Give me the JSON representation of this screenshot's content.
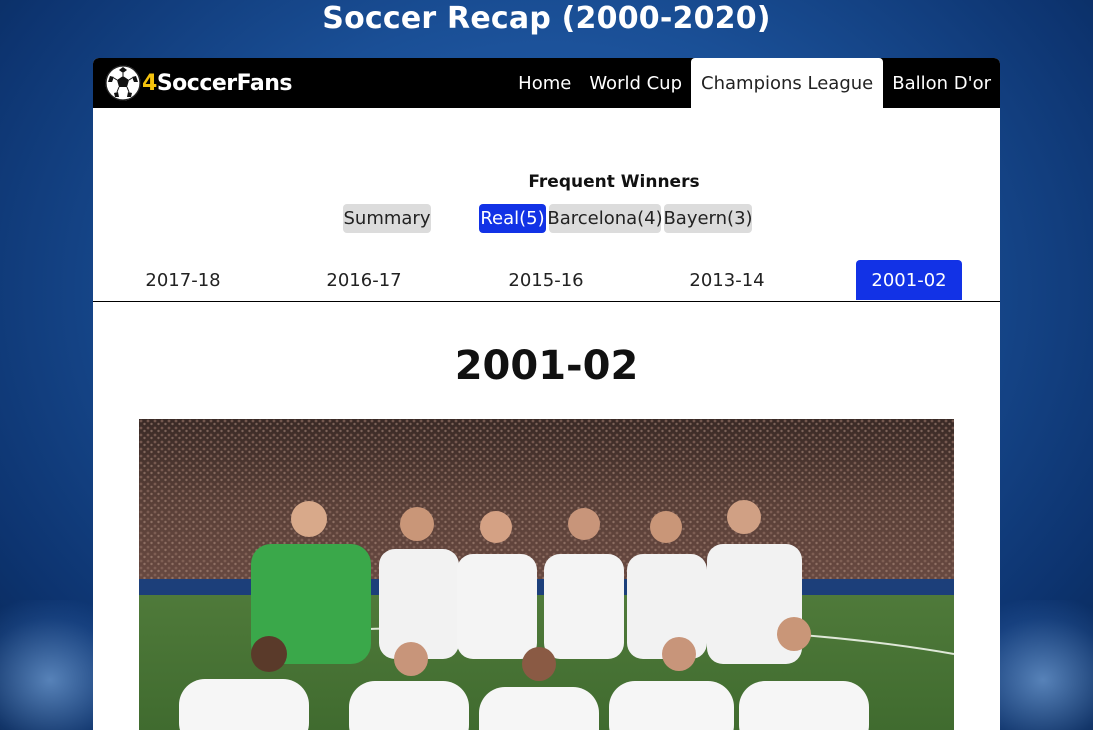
{
  "site_title": "Soccer Recap (2000-2020)",
  "brand": {
    "prefix": "4",
    "name": "SoccerFans",
    "logo_icon": "soccer-ball-icon"
  },
  "nav": {
    "items": [
      {
        "label": "Home"
      },
      {
        "label": "World Cup"
      },
      {
        "label": "Champions League",
        "active": true
      },
      {
        "label": "Ballon D'or"
      }
    ]
  },
  "winners": {
    "heading": "Frequent Winners",
    "summary_label": "Summary",
    "clubs": [
      {
        "label": "Real(5)",
        "active": true
      },
      {
        "label": "Barcelona(4)"
      },
      {
        "label": "Bayern(3)"
      }
    ]
  },
  "seasons": {
    "tabs": [
      {
        "label": "2017-18"
      },
      {
        "label": "2016-17"
      },
      {
        "label": "2015-16"
      },
      {
        "label": "2013-14"
      },
      {
        "label": "2001-02",
        "active": true
      }
    ],
    "selected_title": "2001-02"
  },
  "colors": {
    "accent": "#1232e6",
    "nav_bg": "#000000",
    "brand_digit": "#f4c20d",
    "pill_bg": "#dcdcdc"
  }
}
